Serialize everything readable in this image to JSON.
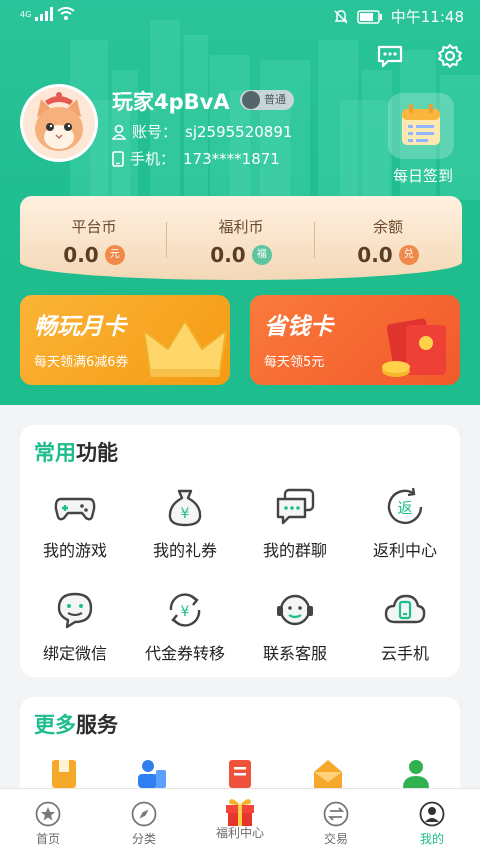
{
  "status_bar": {
    "network": "4G",
    "time": "中午11:48"
  },
  "profile": {
    "username": "玩家4pBvA",
    "level_badge": "普通",
    "account_label": "账号：",
    "account_value": "sj2595520891",
    "phone_label": "手机：",
    "phone_value": "173****1871",
    "checkin_label": "每日签到"
  },
  "wallet": {
    "items": [
      {
        "label": "平台币",
        "value": "0.0",
        "coin": "元",
        "coin_color": "#f08a4b"
      },
      {
        "label": "福利币",
        "value": "0.0",
        "coin": "福",
        "coin_color": "#5fc4a0"
      },
      {
        "label": "余额",
        "value": "0.0",
        "coin": "兑",
        "coin_color": "#f08a4b"
      }
    ]
  },
  "cards": {
    "monthly": {
      "title": "畅玩月卡",
      "subtitle": "每天领满6减6券"
    },
    "saver": {
      "title": "省钱卡",
      "subtitle": "每天领5元"
    }
  },
  "common": {
    "title_highlight": "常用",
    "title_rest": "功能",
    "items": [
      {
        "label": "我的游戏",
        "icon": "gamepad-icon"
      },
      {
        "label": "我的礼券",
        "icon": "money-bag-icon"
      },
      {
        "label": "我的群聊",
        "icon": "chat-bubbles-icon"
      },
      {
        "label": "返利中心",
        "icon": "rebate-icon"
      },
      {
        "label": "绑定微信",
        "icon": "wechat-icon"
      },
      {
        "label": "代金券转移",
        "icon": "voucher-transfer-icon"
      },
      {
        "label": "联系客服",
        "icon": "headset-icon"
      },
      {
        "label": "云手机",
        "icon": "cloud-phone-icon"
      }
    ]
  },
  "more": {
    "title_highlight": "更多",
    "title_rest": "服务"
  },
  "tabs": [
    {
      "label": "首页",
      "icon": "home-star-icon"
    },
    {
      "label": "分类",
      "icon": "compass-icon"
    },
    {
      "label": "福利中心",
      "icon": "gift-icon"
    },
    {
      "label": "交易",
      "icon": "exchange-icon"
    },
    {
      "label": "我的",
      "icon": "profile-icon",
      "active": true
    }
  ],
  "colors": {
    "brand_green": "#1fbc8d",
    "wallet_bg": "#f6dcbd",
    "monthly_card": "#f6a51c",
    "saver_card": "#f26a2e"
  }
}
